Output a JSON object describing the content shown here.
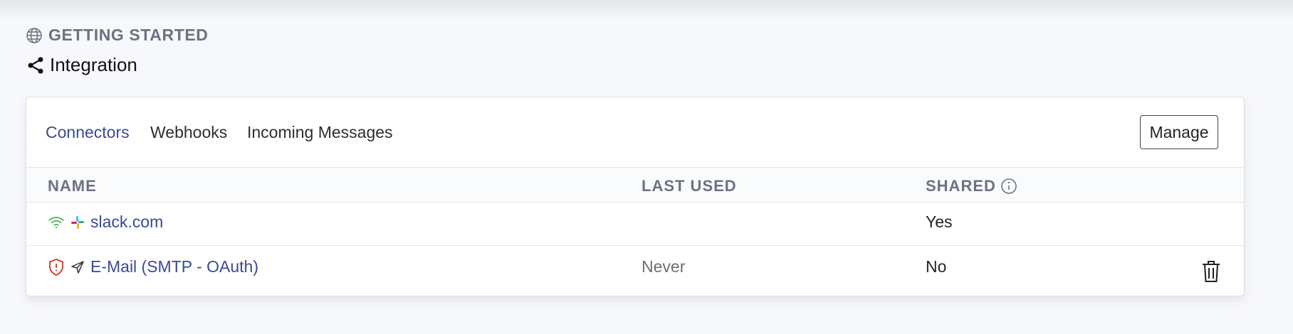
{
  "section": {
    "label": "GETTING STARTED",
    "icon": "globe-icon"
  },
  "page": {
    "title": "Integration",
    "icon": "share-icon"
  },
  "tabs": [
    {
      "label": "Connectors",
      "active": true
    },
    {
      "label": "Webhooks",
      "active": false
    },
    {
      "label": "Incoming Messages",
      "active": false
    }
  ],
  "toolbar": {
    "manage_label": "Manage"
  },
  "table": {
    "columns": [
      "NAME",
      "LAST USED",
      "SHARED"
    ],
    "rows": [
      {
        "status_icon": "wifi-icon",
        "service_icon": "slack-icon",
        "name": "slack.com",
        "last_used": "",
        "shared": "Yes"
      },
      {
        "status_icon": "shield-alert-icon",
        "service_icon": "paper-plane-icon",
        "name": "E-Mail (SMTP - OAuth)",
        "last_used": "Never",
        "shared": "No",
        "action_icon": "trash-icon"
      }
    ]
  },
  "colors": {
    "accent": "#3a4a95",
    "muted": "#6b7280",
    "status_ok": "#4caf50",
    "status_alert": "#d93025",
    "background": "#f7f8fb"
  }
}
